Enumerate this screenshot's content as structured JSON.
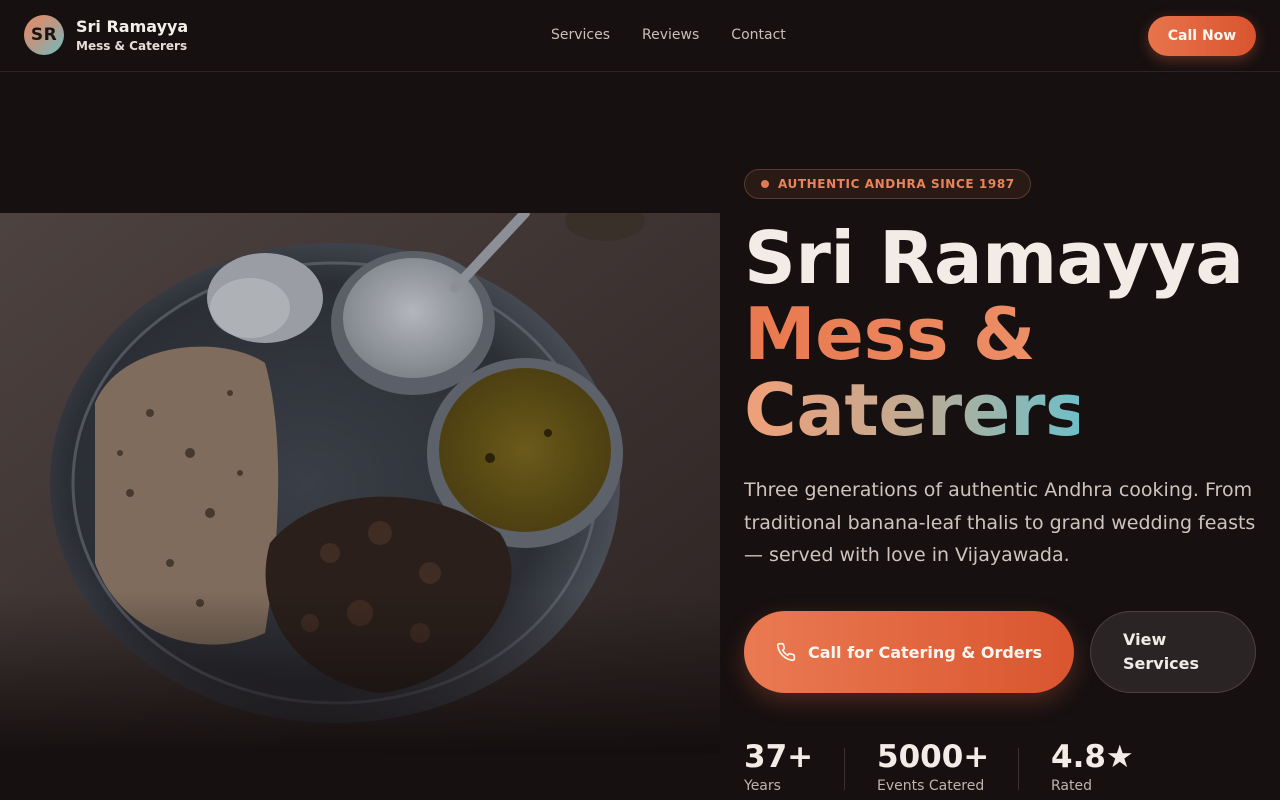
{
  "brand": {
    "logo_initials": "SR",
    "name": "Sri Ramayya",
    "subtitle": "Mess & Caterers"
  },
  "nav": {
    "items": [
      "Services",
      "Reviews",
      "Contact"
    ]
  },
  "header": {
    "call_now_label": "Call Now"
  },
  "hero": {
    "badge": "AUTHENTIC ANDHRA SINCE 1987",
    "title_line1": "Sri Ramayya",
    "title_line2": "Mess &",
    "title_line3": "Caterers",
    "description": "Three generations of authentic Andhra cooking. From traditional banana-leaf thalis to grand wedding feasts — served with love in Vijayawada.",
    "primary_cta": "Call for Catering & Orders",
    "secondary_cta": "View Services",
    "image_subject": "thali plate with rice, curd, dal, chapati and curry"
  },
  "stats": [
    {
      "value": "37+",
      "label": "Years"
    },
    {
      "value": "5000+",
      "label": "Events Catered"
    },
    {
      "value": "4.8★",
      "label": "Rated"
    }
  ],
  "colors": {
    "background": "#161011",
    "accent": "#e8744c",
    "accent_dark": "#d9542f",
    "teal": "#6fbfc8",
    "text": "#f3ece6",
    "muted_text": "#cfc4bd"
  },
  "icons": {
    "cta_icon": "phone-icon"
  }
}
